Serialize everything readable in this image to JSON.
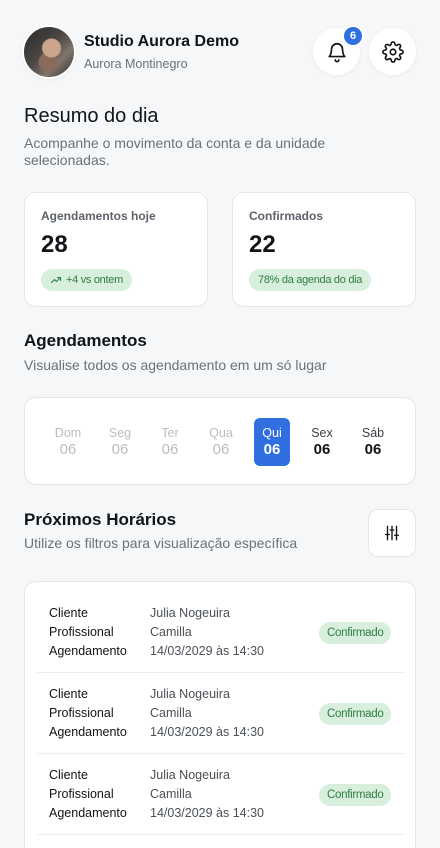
{
  "header": {
    "studio_name": "Studio Aurora Demo",
    "user_name": "Aurora Montinegro",
    "notification_count": "6"
  },
  "summary": {
    "title": "Resumo do dia",
    "description": "Acompanhe o movimento da conta e da unidade selecionadas.",
    "cards": [
      {
        "label": "Agendamentos hoje",
        "value": "28",
        "pill": "+4 vs ontem",
        "pill_icon": "trending-up-icon"
      },
      {
        "label": "Confirmados",
        "value": "22",
        "pill": "78% da agenda do dia"
      }
    ]
  },
  "appointments_section": {
    "title": "Agendamentos",
    "description": "Visualise todos os agendamento em um só lugar",
    "days": [
      {
        "name": "Dom",
        "date": "06",
        "state": "past"
      },
      {
        "name": "Seg",
        "date": "06",
        "state": "past"
      },
      {
        "name": "Ter",
        "date": "06",
        "state": "past"
      },
      {
        "name": "Qua",
        "date": "06",
        "state": "past"
      },
      {
        "name": "Qui",
        "date": "06",
        "state": "selected"
      },
      {
        "name": "Sex",
        "date": "06",
        "state": "future"
      },
      {
        "name": "Sáb",
        "date": "06",
        "state": "future"
      }
    ]
  },
  "upcoming": {
    "title": "Próximos Horários",
    "description": "Utilize os filtros para visualização específica",
    "filter_icon": "sliders-icon",
    "labels": {
      "client": "Cliente",
      "professional": "Profissional",
      "schedule": "Agendamento"
    },
    "items": [
      {
        "client": "Julia Nogeuira",
        "professional": "Camilla",
        "schedule": "14/03/2029 às 14:30",
        "status": "Confirmado"
      },
      {
        "client": "Julia Nogeuira",
        "professional": "Camilla",
        "schedule": "14/03/2029 às 14:30",
        "status": "Confirmado"
      },
      {
        "client": "Julia Nogeuira",
        "professional": "Camilla",
        "schedule": "14/03/2029 às 14:30",
        "status": "Confirmado"
      }
    ]
  },
  "colors": {
    "accent": "#2f6fe0",
    "success_bg": "#d9efdd",
    "success_text": "#2e7d43"
  }
}
